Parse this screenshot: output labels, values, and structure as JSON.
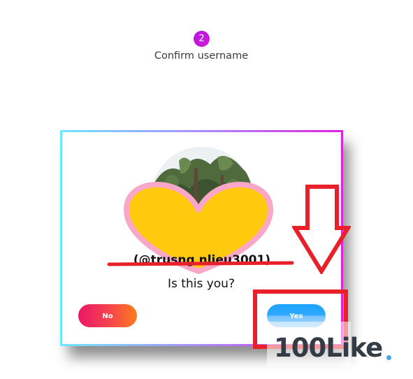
{
  "step": {
    "number": "2",
    "label": "Confirm username"
  },
  "dialog": {
    "username": "(@trusng       nlieu3001)",
    "question": "Is this you?",
    "no_label": "No",
    "yes_label": "Yes"
  },
  "watermark": {
    "text": "100Like"
  },
  "colors": {
    "step_badge": "#c01ae2",
    "highlight": "#e8202a",
    "heart_fill": "#ffc90e",
    "heart_outline": "#f9a7c8",
    "no_button": "#f4414f",
    "yes_button": "#1aa3ff"
  }
}
